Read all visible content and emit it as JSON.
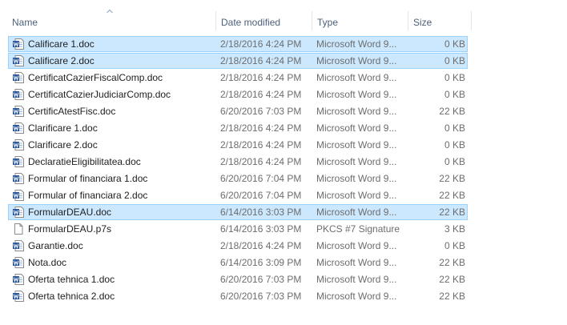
{
  "columns": {
    "name": "Name",
    "date": "Date modified",
    "type": "Type",
    "size": "Size"
  },
  "sort": {
    "column": "name",
    "direction": "ascending",
    "icon": "sort-up-arrow-icon"
  },
  "colors": {
    "selected_bg": "#cce8ff",
    "selected_border": "#99d1ff",
    "word_blue": "#2b579a"
  },
  "files": [
    {
      "name": "Calificare 1.doc",
      "date": "2/18/2016 4:24 PM",
      "type": "Microsoft Word 9...",
      "size": "0 KB",
      "icon": "word-doc-icon",
      "state": "selected"
    },
    {
      "name": "Calificare 2.doc",
      "date": "2/18/2016 4:24 PM",
      "type": "Microsoft Word 9...",
      "size": "0 KB",
      "icon": "word-doc-icon",
      "state": "selected"
    },
    {
      "name": "CertificatCazierFiscalComp.doc",
      "date": "2/18/2016 4:24 PM",
      "type": "Microsoft Word 9...",
      "size": "0 KB",
      "icon": "word-doc-icon",
      "state": ""
    },
    {
      "name": "CertificatCazierJudiciarComp.doc",
      "date": "2/18/2016 4:24 PM",
      "type": "Microsoft Word 9...",
      "size": "0 KB",
      "icon": "word-doc-icon",
      "state": ""
    },
    {
      "name": "CertificAtestFisc.doc",
      "date": "6/20/2016 7:03 PM",
      "type": "Microsoft Word 9...",
      "size": "22 KB",
      "icon": "word-doc-icon",
      "state": ""
    },
    {
      "name": "Clarificare 1.doc",
      "date": "2/18/2016 4:24 PM",
      "type": "Microsoft Word 9...",
      "size": "0 KB",
      "icon": "word-doc-icon",
      "state": ""
    },
    {
      "name": "Clarificare 2.doc",
      "date": "2/18/2016 4:24 PM",
      "type": "Microsoft Word 9...",
      "size": "0 KB",
      "icon": "word-doc-icon",
      "state": ""
    },
    {
      "name": "DeclaratieEligibilitatea.doc",
      "date": "2/18/2016 4:24 PM",
      "type": "Microsoft Word 9...",
      "size": "0 KB",
      "icon": "word-doc-icon",
      "state": ""
    },
    {
      "name": "Formular of financiara 1.doc",
      "date": "6/20/2016 7:04 PM",
      "type": "Microsoft Word 9...",
      "size": "22 KB",
      "icon": "word-doc-icon",
      "state": ""
    },
    {
      "name": "Formular of financiara 2.doc",
      "date": "6/20/2016 7:04 PM",
      "type": "Microsoft Word 9...",
      "size": "22 KB",
      "icon": "word-doc-icon",
      "state": ""
    },
    {
      "name": "FormularDEAU.doc",
      "date": "6/14/2016 3:03 PM",
      "type": "Microsoft Word 9...",
      "size": "22 KB",
      "icon": "word-doc-icon",
      "state": "selected"
    },
    {
      "name": "FormularDEAU.p7s",
      "date": "6/14/2016 3:03 PM",
      "type": "PKCS #7 Signature",
      "size": "3 KB",
      "icon": "blank-file-icon",
      "state": ""
    },
    {
      "name": "Garantie.doc",
      "date": "2/18/2016 4:24 PM",
      "type": "Microsoft Word 9...",
      "size": "0 KB",
      "icon": "word-doc-icon",
      "state": ""
    },
    {
      "name": "Nota.doc",
      "date": "6/14/2016 3:09 PM",
      "type": "Microsoft Word 9...",
      "size": "22 KB",
      "icon": "word-doc-icon",
      "state": ""
    },
    {
      "name": "Oferta tehnica 1.doc",
      "date": "6/20/2016 7:03 PM",
      "type": "Microsoft Word 9...",
      "size": "22 KB",
      "icon": "word-doc-icon",
      "state": ""
    },
    {
      "name": "Oferta tehnica 2.doc",
      "date": "6/20/2016 7:03 PM",
      "type": "Microsoft Word 9...",
      "size": "22 KB",
      "icon": "word-doc-icon",
      "state": ""
    }
  ]
}
